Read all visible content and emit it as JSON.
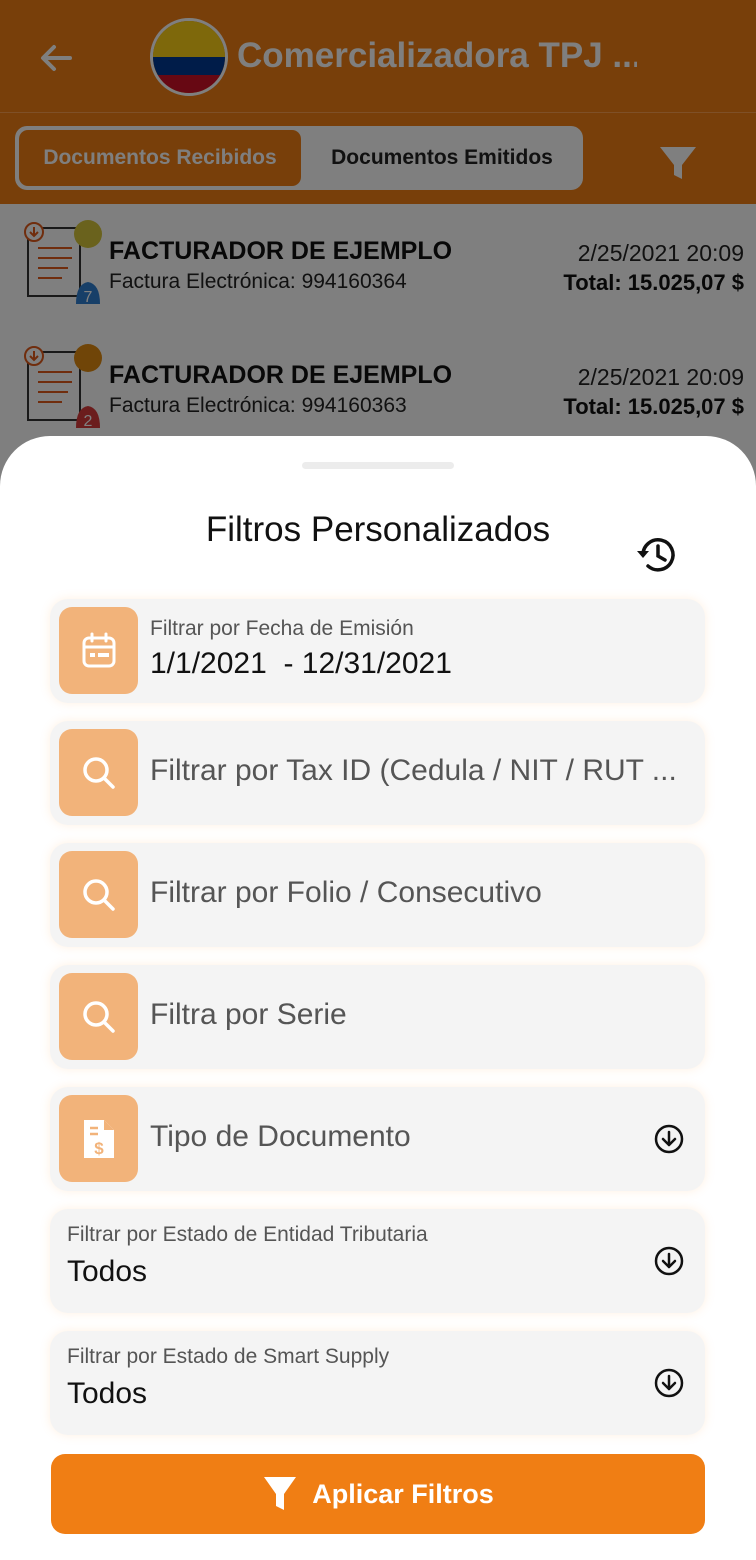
{
  "header": {
    "title": "Comercializadora TPJ ...",
    "tabs": [
      {
        "label": "Documentos Recibidos",
        "active": true
      },
      {
        "label": "Documentos Emitidos",
        "active": false
      }
    ]
  },
  "documents": [
    {
      "issuer": "FACTURADOR DE EJEMPLO",
      "doc": "Factura Electrónica: 994160364",
      "date": "2/25/2021 20:09",
      "total": "Total: 15.025,07 $",
      "badge": "7",
      "dot_color": "#d4c43a",
      "bell_color": "#2f7fd1"
    },
    {
      "issuer": "FACTURADOR DE EJEMPLO",
      "doc": "Factura Electrónica: 994160363",
      "date": "2/25/2021 20:09",
      "total": "Total: 15.025,07 $",
      "badge": "2",
      "dot_color": "#e08a10",
      "bell_color": "#d63a3a"
    }
  ],
  "sheet": {
    "title": "Filtros Personalizados",
    "date_filter": {
      "label": "Filtrar por Fecha de Emisión",
      "value": "1/1/2021  - 12/31/2021"
    },
    "taxid_placeholder": "Filtrar por Tax ID (Cedula / NIT / RUT ...",
    "folio_placeholder": "Filtrar por Folio / Consecutivo",
    "serie_placeholder": "Filtra por Serie",
    "doc_type_placeholder": "Tipo de Documento",
    "entity_status": {
      "label": "Filtrar por Estado de Entidad Tributaria",
      "value": "Todos"
    },
    "smart_supply_status": {
      "label": "Filtrar por Estado de Smart Supply",
      "value": "Todos"
    },
    "apply_label": "Aplicar Filtros"
  },
  "colors": {
    "primary": "#f07e14",
    "tile": "#f2b37a",
    "field_bg": "#f4f4f4"
  }
}
